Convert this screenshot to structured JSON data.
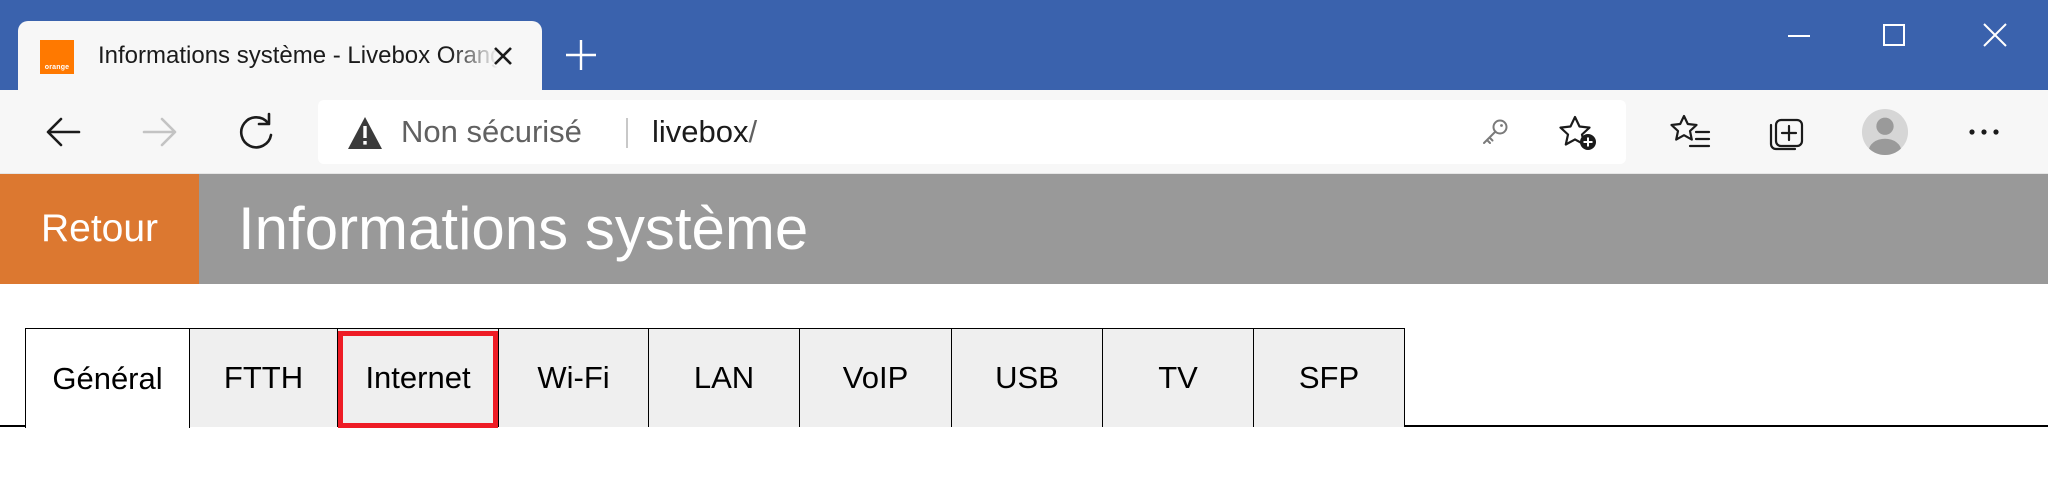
{
  "browser": {
    "tab": {
      "favicon_text": "orange",
      "title": "Informations système - Livebox Orange"
    },
    "address": {
      "security_label": "Non sécurisé",
      "url_host": "livebox",
      "url_path": "/"
    },
    "icons": {
      "back": "back-arrow-icon",
      "forward": "forward-arrow-icon",
      "reload": "reload-icon",
      "warning": "warning-triangle-icon",
      "key": "key-icon",
      "add_favorite": "star-plus-icon",
      "favorites": "favorites-list-icon",
      "collections": "collections-icon",
      "profile": "avatar-icon",
      "menu": "more-dots-icon"
    }
  },
  "page": {
    "back_label": "Retour",
    "title": "Informations système",
    "tabs": [
      {
        "label": "Général",
        "active": true
      },
      {
        "label": "FTTH",
        "active": false
      },
      {
        "label": "Internet",
        "active": false,
        "highlighted": true
      },
      {
        "label": "Wi-Fi",
        "active": false
      },
      {
        "label": "LAN",
        "active": false
      },
      {
        "label": "VoIP",
        "active": false
      },
      {
        "label": "USB",
        "active": false
      },
      {
        "label": "TV",
        "active": false
      },
      {
        "label": "SFP",
        "active": false
      }
    ]
  },
  "colors": {
    "titlebar": "#3a62ad",
    "header_bg": "#999999",
    "back_button_bg": "#dc7830",
    "highlight": "#ee1c25",
    "favicon": "#ff7900"
  }
}
